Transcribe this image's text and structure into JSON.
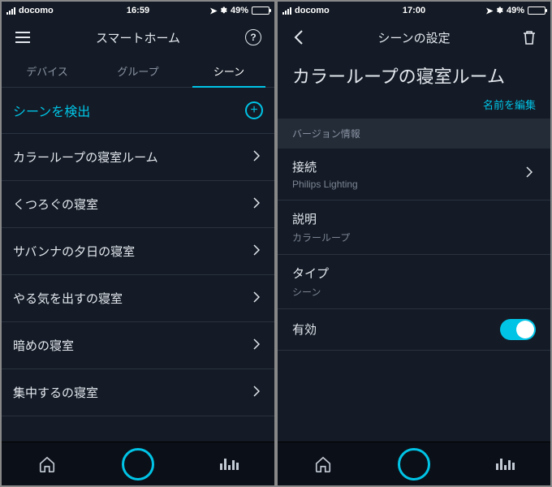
{
  "left": {
    "status": {
      "carrier": "docomo",
      "time": "16:59",
      "battery_pct": "49%"
    },
    "nav": {
      "title": "スマートホーム"
    },
    "tabs": {
      "devices": "デバイス",
      "groups": "グループ",
      "scenes": "シーン"
    },
    "section": {
      "detect_label": "シーンを検出"
    },
    "scenes": [
      {
        "label": "カラーループの寝室ルーム"
      },
      {
        "label": "くつろぐの寝室"
      },
      {
        "label": "サバンナの夕日の寝室"
      },
      {
        "label": "やる気を出すの寝室"
      },
      {
        "label": "暗めの寝室"
      },
      {
        "label": "集中するの寝室"
      }
    ]
  },
  "right": {
    "status": {
      "carrier": "docomo",
      "time": "17:00",
      "battery_pct": "49%"
    },
    "nav": {
      "title": "シーンの設定"
    },
    "detail": {
      "title": "カラーループの寝室ルーム",
      "edit_label": "名前を編集"
    },
    "group_header": "バージョン情報",
    "info": {
      "connection_k": "接続",
      "connection_v": "Philips Lighting",
      "description_k": "説明",
      "description_v": "カラーループ",
      "type_k": "タイプ",
      "type_v": "シーン",
      "enabled_k": "有効",
      "enabled": true
    }
  }
}
